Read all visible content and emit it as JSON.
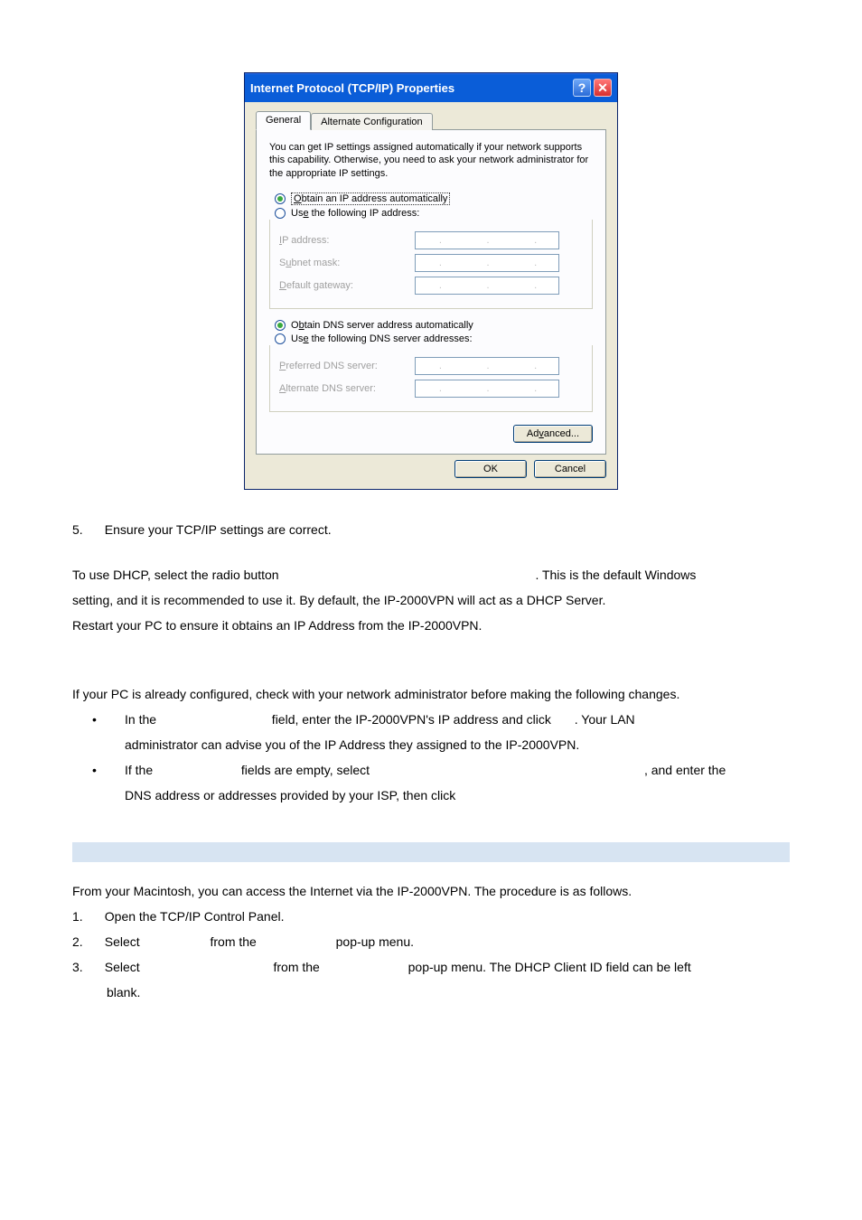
{
  "dialog": {
    "title": "Internet Protocol (TCP/IP) Properties",
    "tabs": {
      "general": "General",
      "alt": "Alternate Configuration"
    },
    "desc": "You can get IP settings assigned automatically if your network supports this capability. Otherwise, you need to ask your network administrator for the appropriate IP settings.",
    "ip_group": {
      "auto_underline": "O",
      "auto_rest": "btain an IP address automatically",
      "manual_pre": "Us",
      "manual_ul": "e",
      "manual_post": " the following IP address:",
      "ip_label_ul": "I",
      "ip_label_rest": "P address:",
      "mask_pre": "S",
      "mask_ul": "u",
      "mask_post": "bnet mask:",
      "gw_ul": "D",
      "gw_rest": "efault gateway:"
    },
    "dns_group": {
      "auto_pre": "O",
      "auto_ul": "b",
      "auto_post": "tain DNS server address automatically",
      "manual_pre": "Us",
      "manual_ul": "e",
      "manual_post": " the following DNS server addresses:",
      "pref_ul": "P",
      "pref_rest": "referred DNS server:",
      "alt_ul": "A",
      "alt_rest": "lternate DNS server:"
    },
    "advanced_pre": "Ad",
    "advanced_ul": "v",
    "advanced_post": "anced...",
    "ok": "OK",
    "cancel": "Cancel"
  },
  "doc": {
    "step5": "Ensure your TCP/IP settings are correct.",
    "dhcp_p1a": "To use DHCP, select the radio button ",
    "dhcp_p1b": ". This is the default Windows",
    "dhcp_p2": "setting, and it is recommended to use it. By default, the IP-2000VPN will act as a DHCP Server.",
    "dhcp_p3": "Restart your PC to ensure it obtains an IP Address from the IP-2000VPN.",
    "fixed_intro": "If your PC is already configured, check with your network administrator before making the following changes.",
    "b1a": "In the ",
    "b1b": " field, enter the IP-2000VPN's IP address and click ",
    "b1c": ". Your LAN",
    "b1d": "administrator can advise you of the IP Address they assigned to the IP-2000VPN.",
    "b2a": "If the ",
    "b2b": " fields are empty, select ",
    "b2c": ", and enter the",
    "b2d": "DNS address or addresses provided by your ISP, then click ",
    "mac_intro": "From your Macintosh, you can access the Internet via the IP-2000VPN. The procedure is as follows.",
    "mac1": "Open the TCP/IP Control Panel.",
    "mac2a": "Select ",
    "mac2b": " from the ",
    "mac2c": " pop-up menu.",
    "mac3a": "Select ",
    "mac3b": " from the ",
    "mac3c": " pop-up menu. The DHCP Client ID field can be left",
    "mac3d": "blank."
  }
}
